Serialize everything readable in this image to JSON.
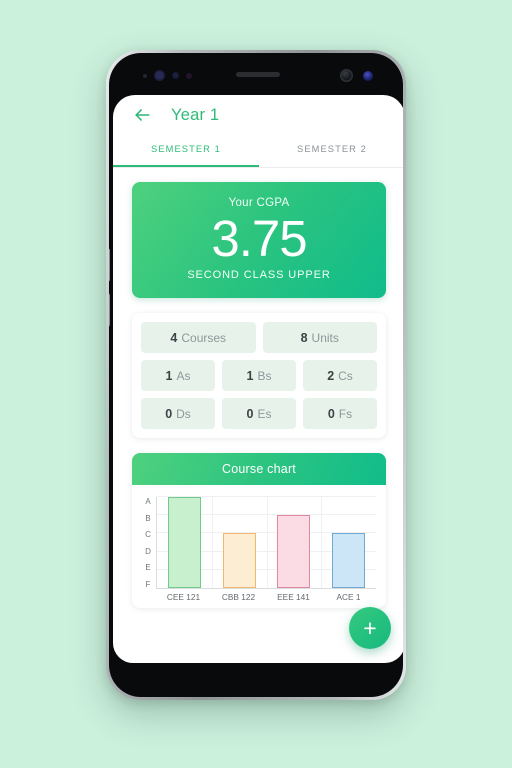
{
  "app": {
    "page_title": "Year 1",
    "back_icon": "back-arrow-icon"
  },
  "tabs": [
    {
      "label": "SEMESTER 1",
      "active": true
    },
    {
      "label": "SEMESTER 2",
      "active": false
    }
  ],
  "cgpa_card": {
    "label": "Your CGPA",
    "value": "3.75",
    "classification": "SECOND CLASS UPPER",
    "gradient_from": "#4ed17e",
    "gradient_to": "#10bc8b"
  },
  "stats": {
    "rows": [
      [
        {
          "num": "4",
          "label": "Courses"
        },
        {
          "num": "8",
          "label": "Units"
        }
      ],
      [
        {
          "num": "1",
          "label": "As"
        },
        {
          "num": "1",
          "label": "Bs"
        },
        {
          "num": "2",
          "label": "Cs"
        }
      ],
      [
        {
          "num": "0",
          "label": "Ds"
        },
        {
          "num": "0",
          "label": "Es"
        },
        {
          "num": "0",
          "label": "Fs"
        }
      ]
    ],
    "pill_color": "#e7f3ea"
  },
  "chart_card": {
    "title": "Course chart"
  },
  "fab": {
    "icon": "plus-icon",
    "label": "+",
    "color": "#16b97f"
  },
  "chart_data": {
    "type": "bar",
    "title": "Course chart",
    "xlabel": "",
    "ylabel": "",
    "categories": [
      "CEE 121",
      "CBB 122",
      "EEE 141",
      "ACE 1"
    ],
    "grades": [
      "A",
      "C",
      "B",
      "C"
    ],
    "values": [
      5,
      3,
      4,
      3
    ],
    "ytick_labels": [
      "A",
      "B",
      "C",
      "D",
      "E",
      "F"
    ],
    "ytick_values": [
      5,
      4,
      3,
      2,
      1,
      0
    ],
    "ylim": [
      0,
      5
    ],
    "grid": true,
    "legend": false,
    "bar_colors": [
      {
        "fill": "#c8f0cf",
        "border": "#6ecb8a"
      },
      {
        "fill": "#fdedd2",
        "border": "#f0b96b"
      },
      {
        "fill": "#fbdbe4",
        "border": "#e2879f"
      },
      {
        "fill": "#cde6f7",
        "border": "#6fa8d4"
      }
    ]
  }
}
